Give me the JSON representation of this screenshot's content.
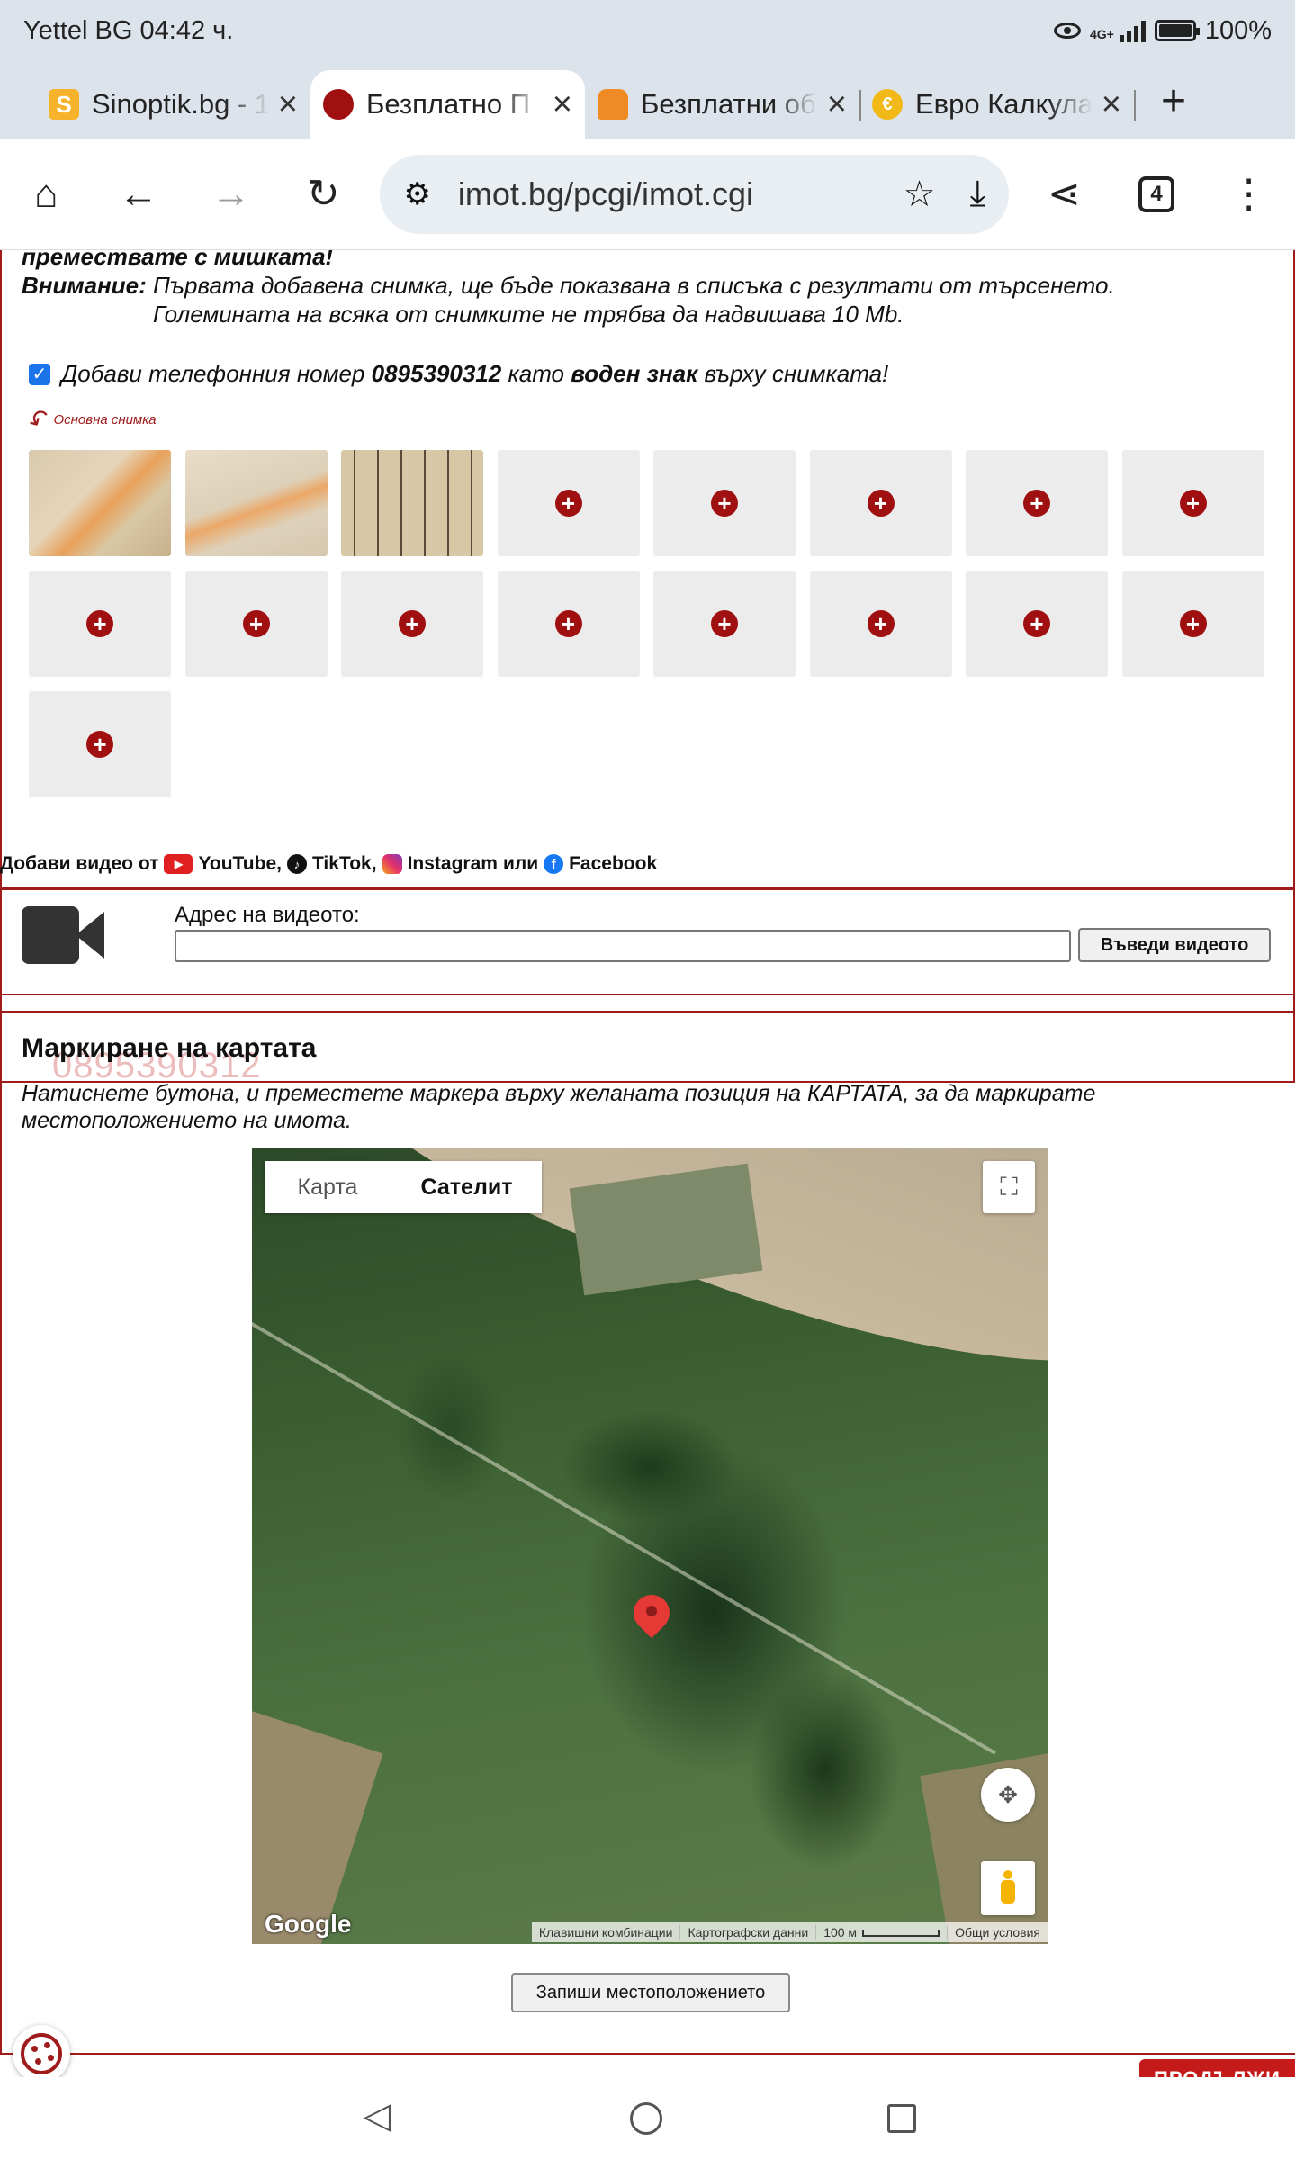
{
  "status_bar": {
    "carrier": "Yettel BG",
    "time": "04:42 ч.",
    "network": "4G+",
    "battery": "100%"
  },
  "tabs": [
    {
      "title": "Sinoptik.bg - 1",
      "favicon": "sinoptik-icon",
      "favicon_color": "#f7b32b"
    },
    {
      "title": "Безплатно П",
      "favicon": "imot-icon",
      "favicon_color": "#a01010",
      "active": true
    },
    {
      "title": "Безплатни об",
      "favicon": "bag-icon",
      "favicon_color": "#f08a24"
    },
    {
      "title": "Евро Калкулат",
      "favicon": "euro-icon",
      "favicon_color": "#f2b817"
    }
  ],
  "toolbar": {
    "url": "imot.bg/pcgi/imot.cgi",
    "tab_count": "4"
  },
  "upload": {
    "drag_hint": "премествате с мишката!",
    "warning_label": "Внимание:",
    "warning_line1": "Първата добавена снимка, ще бъде показвана в списъка с резултати от търсенето.",
    "warning_line2": "Големината на всяка от снимките не трябва да надвишава 10 Mb.",
    "watermark_prefix": "Добави телефонния номер",
    "phone": "0895390312",
    "watermark_middle": "като",
    "watermark_bold": "воден знак",
    "watermark_suffix": "върху снимката!",
    "watermark_checked": true,
    "main_photo_label": "Основна снимка",
    "uploaded_count": 3,
    "empty_slots": 14
  },
  "video": {
    "label_prefix": "Добави видео от",
    "youtube": "YouTube,",
    "tiktok": "TikTok,",
    "instagram": "Instagram",
    "or": "или",
    "facebook": "Facebook",
    "address_label": "Адрес на видеото:",
    "address_value": "",
    "submit_label": "Въведи видеото"
  },
  "map": {
    "title": "Маркиране на картата",
    "watermark": "0895390312",
    "description": "Натиснете бутона, и преместете маркера върху желаната позиция на КАРТАТА, за да маркирате местоположението на имота.",
    "type_map": "Карта",
    "type_satellite": "Сателит",
    "selected_type": "Сателит",
    "google": "Google",
    "attrib_shortcuts": "Клавишни комбинации",
    "attrib_data": "Картографски данни",
    "attrib_scale": "100 м",
    "attrib_terms": "Общи условия",
    "save_label": "Запиши местоположението"
  },
  "footer": {
    "continue_label": "ПРОДЪЛЖИ"
  }
}
